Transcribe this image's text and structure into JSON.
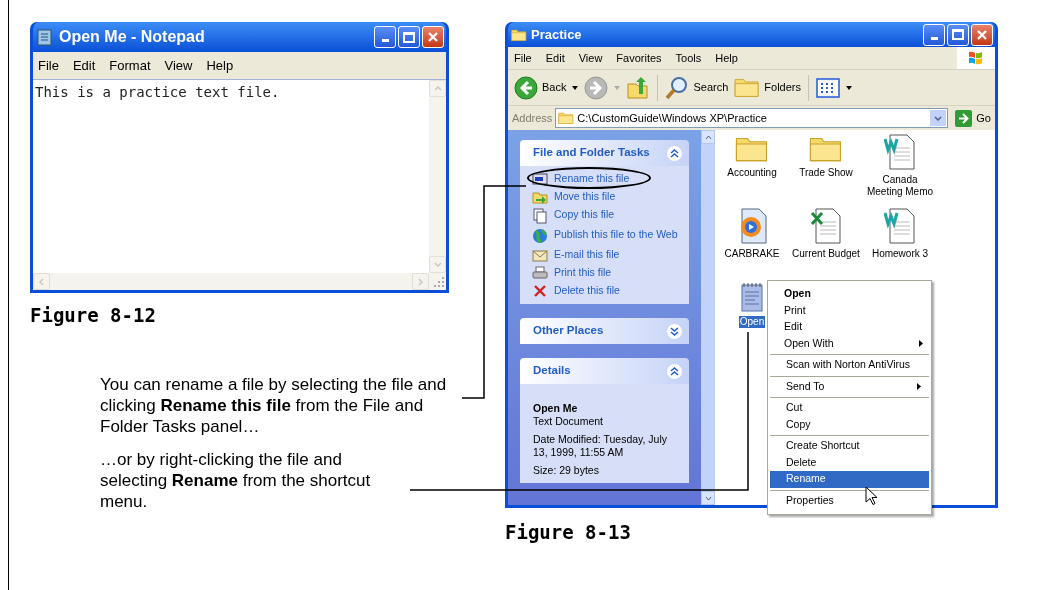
{
  "notepad": {
    "title": "Open Me - Notepad",
    "menu": [
      "File",
      "Edit",
      "Format",
      "View",
      "Help"
    ],
    "text": "This is a practice text file.",
    "caption": "Figure 8-12"
  },
  "explorer": {
    "title": "Practice",
    "menu": [
      "File",
      "Edit",
      "View",
      "Favorites",
      "Tools",
      "Help"
    ],
    "toolbar": [
      {
        "kind": "back",
        "label": "Back",
        "disabled": false
      },
      {
        "kind": "forward",
        "disabled": true
      },
      {
        "kind": "up"
      },
      {
        "kind": "search",
        "label": "Search"
      },
      {
        "kind": "folders",
        "label": "Folders"
      },
      {
        "kind": "views"
      }
    ],
    "address_label": "Address",
    "address": "C:\\CustomGuide\\Windows XP\\Practice",
    "go": "Go",
    "panels": [
      {
        "title": "File and Folder Tasks",
        "expanded": true,
        "items": [
          {
            "kind": "rename",
            "label": "Rename this file",
            "circled": true
          },
          {
            "kind": "move",
            "label": "Move this file",
            "circled": false
          },
          {
            "kind": "copy",
            "label": "Copy this file",
            "circled": false
          },
          {
            "kind": "globe",
            "label": "Publish this file to the Web",
            "circled": false
          },
          {
            "kind": "mail",
            "label": "E-mail this file",
            "circled": false
          },
          {
            "kind": "print",
            "label": "Print this file",
            "circled": false
          },
          {
            "kind": "delete",
            "label": "Delete this file",
            "circled": false
          }
        ]
      },
      {
        "title": "Other Places",
        "expanded": false
      },
      {
        "title": "Details",
        "expanded": true,
        "details": {
          "name": "Open Me",
          "type": "Text Document",
          "modified": "Date Modified: Tuesday, July 13, 1999, 11:55 AM",
          "size": "Size: 29 bytes"
        }
      }
    ],
    "files": [
      {
        "kind": "folder",
        "name": "Accounting",
        "selected": false
      },
      {
        "kind": "folder",
        "name": "Trade Show",
        "selected": false
      },
      {
        "kind": "word",
        "name": "Canada Meeting Memo",
        "selected": false
      },
      {
        "kind": "media",
        "name": "CARBRAKE",
        "selected": false
      },
      {
        "kind": "excel",
        "name": "Current Budget",
        "selected": false
      },
      {
        "kind": "word",
        "name": "Homework 3",
        "selected": false
      },
      {
        "kind": "text",
        "name": "Open",
        "selected": true
      }
    ],
    "context_menu": [
      [
        {
          "label": "Open",
          "default": true,
          "submenu": false,
          "selected": false
        },
        {
          "label": "Print",
          "default": false,
          "submenu": false,
          "selected": false
        },
        {
          "label": "Edit",
          "default": false,
          "submenu": false,
          "selected": false
        },
        {
          "label": "Open With",
          "default": false,
          "submenu": true,
          "selected": false
        }
      ],
      [
        {
          "label": "Scan with Norton AntiVirus",
          "default": false,
          "submenu": false,
          "selected": false
        }
      ],
      [
        {
          "label": "Send To",
          "default": false,
          "submenu": true,
          "selected": false
        }
      ],
      [
        {
          "label": "Cut",
          "default": false,
          "submenu": false,
          "selected": false
        },
        {
          "label": "Copy",
          "default": false,
          "submenu": false,
          "selected": false
        }
      ],
      [
        {
          "label": "Create Shortcut",
          "default": false,
          "submenu": false,
          "selected": false
        },
        {
          "label": "Delete",
          "default": false,
          "submenu": false,
          "selected": false
        },
        {
          "label": "Rename",
          "default": false,
          "submenu": false,
          "selected": true
        }
      ],
      [
        {
          "label": "Properties",
          "default": false,
          "submenu": false,
          "selected": false
        }
      ]
    ],
    "caption": "Figure 8-13"
  },
  "callouts": [
    "You can rename a file by selecting the file and clicking **Rename this file** from the File and Folder Tasks panel…",
    "…or by right-clicking the file and selecting **Rename** from the shortcut menu."
  ]
}
